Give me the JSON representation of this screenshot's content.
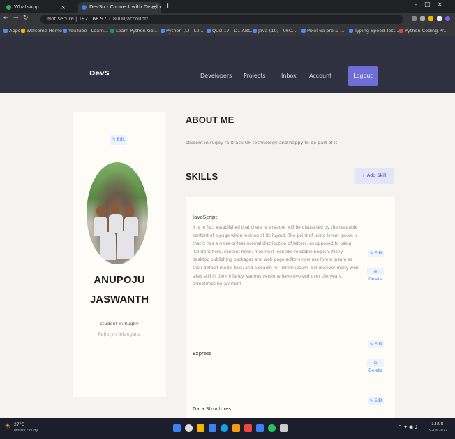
{
  "browser": {
    "tabs": [
      {
        "label": "WhatsApp"
      },
      {
        "label": "DevSo - Connect with Develop"
      }
    ],
    "url": {
      "scheme": "Not secure",
      "host": "192.168.97.1",
      "path": ":8000/account/"
    },
    "bookmarks": [
      "Apps",
      "Welcome Home",
      "YouTube | Learn...",
      "Learn Python Go...",
      "Python (L) - L0...",
      "Quiz 17 - D1 ABC...",
      "Java (10) - 06C...",
      "Pixel 6a pro & ...",
      "Typing Speed Test...",
      "Python Coding Pr..."
    ],
    "colors": {
      "bookmark_icons": [
        "#4c8bf5",
        "#f4b400",
        "#4c8bf5",
        "#0f9d58",
        "#4c8bf5",
        "#4c8bf5",
        "#4c8bf5",
        "#4c8bf5",
        "#4c8bf5",
        "#ea4335"
      ]
    }
  },
  "nav": {
    "logo": "DevS",
    "links": [
      "Developers",
      "Projects",
      "Inbox",
      "Account"
    ],
    "logout": "Logout"
  },
  "profile": {
    "edit_label": "Edit",
    "first_name": "ANUPOJU",
    "last_name": "JASWANTH",
    "headline": "student in Rugby",
    "location": "Rebotyn telangana"
  },
  "about": {
    "title": "ABOUT ME",
    "text": "student in rugby railtrack OF technology and happy to be part of it"
  },
  "skills": {
    "title": "SKILLS",
    "add_label": "+ Add Skill",
    "edit_label": "Edit",
    "delete_label": "Delete",
    "items": [
      {
        "name": "JavaScript",
        "description": "It is in fact established that there is a reader will be distracted by the readable content of a page when looking at its layout. The point of using lorem ipsum is that it has a more-or-less normal distribution of letters, as opposed to using 'Content here, content here', making it look like readable English. Many desktop publishing packages and web page editors now use lorem ipsum as their default model text, and a search for 'lorem ipsum' will uncover many web sites still in their infancy. Various versions have evolved over the years, sometimes by accident."
      },
      {
        "name": "Express",
        "description": ""
      },
      {
        "name": "Data Structures",
        "description": ""
      }
    ]
  },
  "taskbar": {
    "weather_temp": "27°C",
    "weather_desc": "Mostly cloudy",
    "time": "13:08",
    "date": "19-10-2022",
    "icon_colors": [
      "#3b82f6",
      "#dddddd",
      "#f4b400",
      "#3b82f6",
      "#0ea5e9",
      "#f59e0b",
      "#ef4444",
      "#3b82f6",
      "#22c55e",
      "#cccccc"
    ]
  }
}
